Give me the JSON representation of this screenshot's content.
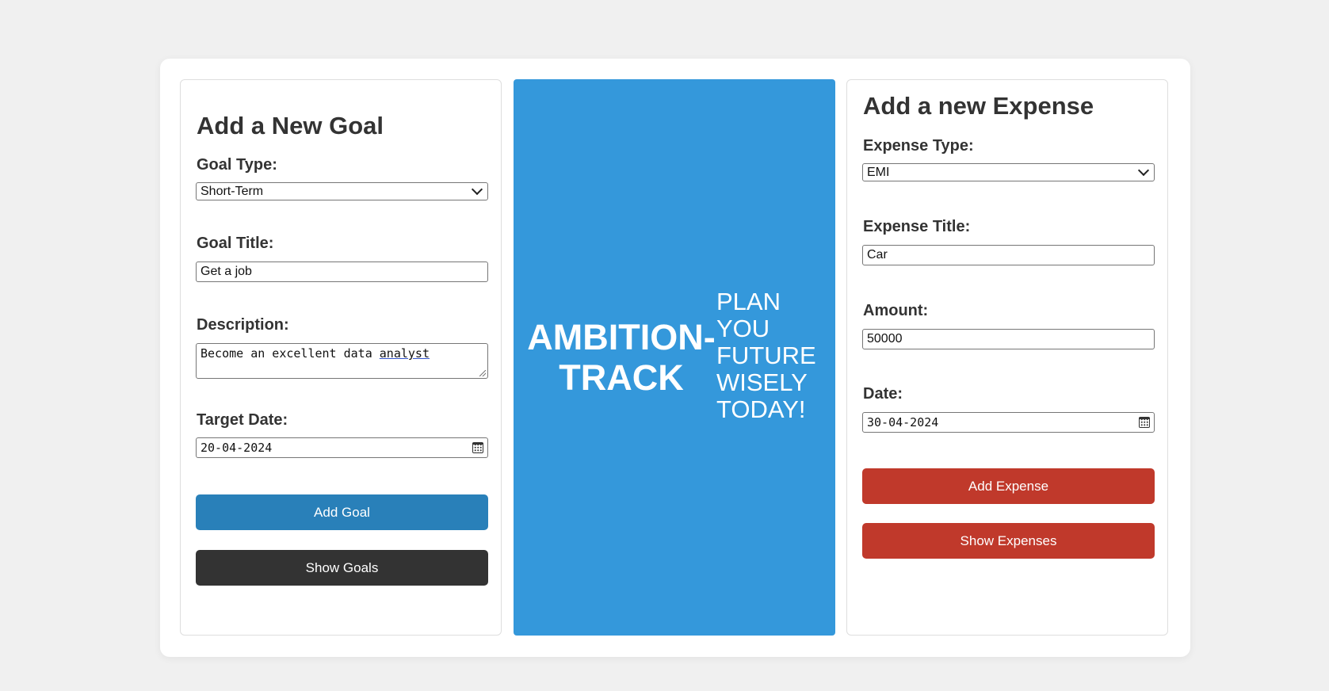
{
  "goal_form": {
    "heading": "Add a New Goal",
    "goal_type_label": "Goal Type:",
    "goal_type_selected": "Short-Term",
    "goal_title_label": "Goal Title:",
    "goal_title_value": "Get a job",
    "description_label": "Description:",
    "description_value_prefix": "Become an excellent data ",
    "description_value_flagged": "analyst",
    "target_date_label": "Target Date:",
    "target_date_value": "20-04-2024",
    "add_button": "Add Goal",
    "show_button": "Show Goals"
  },
  "banner": {
    "brand_line1": "AMBITION-",
    "brand_line2": "TRACK",
    "tagline": [
      "PLAN",
      "YOU",
      "FUTURE",
      "WISELY",
      "TODAY!"
    ],
    "color": "#3498db"
  },
  "expense_form": {
    "heading": "Add a new Expense",
    "expense_type_label": "Expense Type:",
    "expense_type_selected": "EMI",
    "expense_title_label": "Expense Title:",
    "expense_title_value": "Car",
    "amount_label": "Amount:",
    "amount_value": "50000",
    "date_label": "Date:",
    "date_value": "30-04-2024",
    "add_button": "Add Expense",
    "show_button": "Show Expenses"
  },
  "colors": {
    "background": "#f0f0f0",
    "add_goal_button": "#2980b9",
    "show_goals_button": "#333333",
    "expense_buttons": "#c0392b"
  },
  "icons": {
    "select_arrow": "chevron-down-icon",
    "date_picker": "calendar-icon"
  }
}
